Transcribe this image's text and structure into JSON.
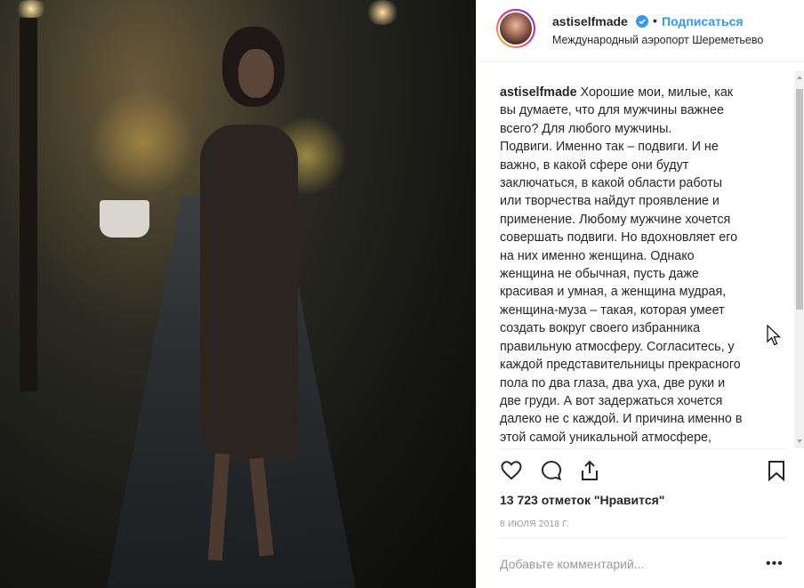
{
  "header": {
    "username": "astiselfmade",
    "verified_icon": "verified-badge-icon",
    "separator": "•",
    "follow_label": "Подписаться",
    "location": "Международный аэропорт Шереметьево"
  },
  "caption": {
    "username": "astiselfmade",
    "text": " Хорошие мои, милые, как\nвы думаете, что для мужчины важнее\nвсего? Для любого мужчины.\nПодвиги. Именно так – подвиги. И не\nважно, в какой сфере они будут\nзаключаться, в какой области работы\nили творчества найдут проявление и\nприменение. Любому мужчине хочется\nсовершать подвиги. Но вдохновляет его\nна них именно женщина. Однако\nженщина не обычная, пусть даже\nкрасивая и умная, а женщина мудрая,\nженщина-муза – такая, которая умеет\nсоздать вокруг своего избранника\nправильную атмосферу. Согласитесь, у\nкаждой представительницы прекрасного\nпола по два глаза, два уха, две руки и\nдве груди. А вот задержаться хочется\nдалеко не с каждой. И причина именно в\nэтой самой уникальной атмосфере,\nкоторая помогает мужчине"
  },
  "actions": {
    "like_icon": "heart-icon",
    "comment_icon": "comment-icon",
    "share_icon": "share-icon",
    "save_icon": "bookmark-icon"
  },
  "likes": "13 723 отметок \"Нравится\"",
  "date": "8 ИЮЛЯ 2018 Г.",
  "comment": {
    "placeholder": "Добавьте комментарий...",
    "more_label": "•••"
  },
  "colors": {
    "accent": "#3897f0",
    "text": "#262626",
    "muted": "#999999",
    "border": "#efefef"
  }
}
